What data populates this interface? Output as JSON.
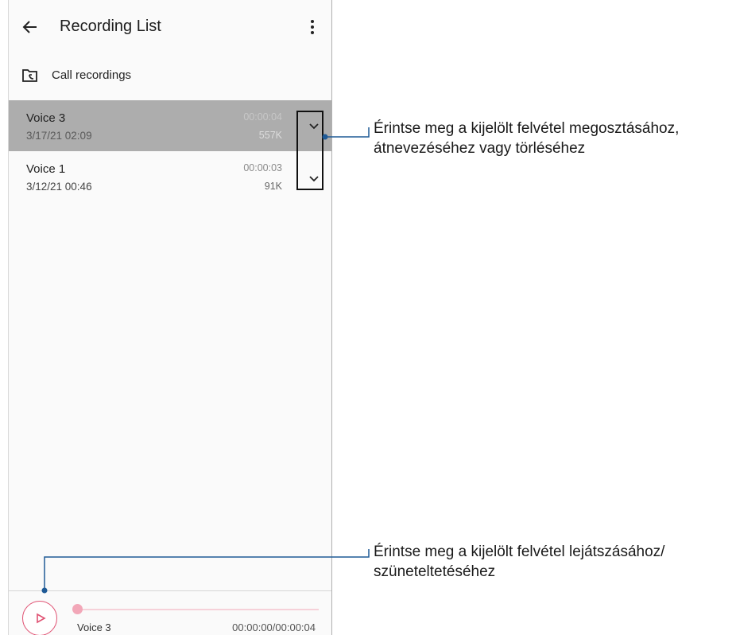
{
  "app_bar": {
    "title": "Recording List",
    "back_icon": "arrow-left-icon",
    "more_icon": "more-vertical-icon"
  },
  "folder": {
    "label": "Call recordings",
    "icon": "folder-call-icon"
  },
  "recordings": [
    {
      "name": "Voice 3",
      "date": "3/17/21 02:09",
      "duration": "00:00:04",
      "size": "557K",
      "selected": true
    },
    {
      "name": "Voice 1",
      "date": "3/12/21 00:46",
      "duration": "00:00:03",
      "size": "91K",
      "selected": false
    }
  ],
  "player": {
    "track_name": "Voice 3",
    "time": "00:00:00/00:00:04",
    "progress": 0,
    "play_icon": "play-icon"
  },
  "callouts": {
    "options_line1": "Érintse meg a kijelölt felvétel megosztásához,",
    "options_line2": "átnevezéséhez vagy törléséhez",
    "play_line1": "Érintse meg a kijelölt felvétel lejátszásához/",
    "play_line2": "szüneteltetéséhez"
  },
  "colors": {
    "accent": "#e05273",
    "leader_line": "#1f5a96",
    "selected_row": "#adadad"
  }
}
